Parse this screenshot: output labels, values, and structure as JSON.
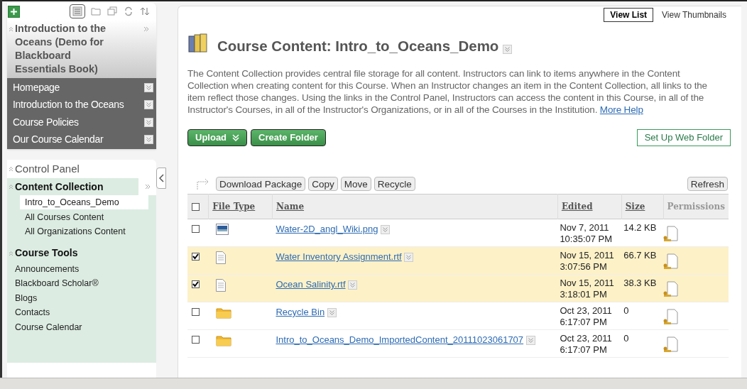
{
  "sidebar": {
    "course_title": "Introduction to the Oceans (Demo for Blackboard Essentials Book)",
    "course_menu": [
      {
        "label": "Homepage"
      },
      {
        "label": "Introduction to the Oceans"
      },
      {
        "label": "Course Policies"
      },
      {
        "label": "Our Course Calendar"
      }
    ],
    "control_panel": {
      "title": "Control Panel",
      "sections": [
        {
          "title": "Content Collection",
          "expand": true,
          "items": [
            {
              "label": "Intro_to_Oceans_Demo",
              "selected": true
            },
            {
              "label": "All Courses Content",
              "selected": false
            },
            {
              "label": "All Organizations Content",
              "selected": false
            }
          ]
        },
        {
          "title": "Course Tools",
          "expand": false,
          "items": [
            {
              "label": "Announcements",
              "selected": false
            },
            {
              "label": "Blackboard Scholar®",
              "selected": false
            },
            {
              "label": "Blogs",
              "selected": false
            },
            {
              "label": "Contacts",
              "selected": false
            },
            {
              "label": "Course Calendar",
              "selected": false
            }
          ]
        }
      ]
    }
  },
  "view_toggle": [
    {
      "label": "View List",
      "selected": true
    },
    {
      "label": "View Thumbnails",
      "selected": false
    }
  ],
  "page_title": "Course Content: Intro_to_Oceans_Demo",
  "description": "The Content Collection provides central file storage for all content. Instructors can link to items anywhere in the Content Collection when creating content for this Course. When an Instructor changes an item in the Content Collection, all links to the item reflect those changes. Using the links in the Control Panel, Instructors can access the content in this Course, in all of the Instructor's Courses, in all of the Instructor's Organizations, or in all of the Courses in the Institution.",
  "help_link": "More Help",
  "action_buttons": [
    {
      "label": "Upload",
      "dropdown": true
    },
    {
      "label": "Create Folder",
      "dropdown": false
    }
  ],
  "web_folder_button": "Set Up Web Folder",
  "toolbar_buttons": [
    "Download Package",
    "Copy",
    "Move",
    "Recycle"
  ],
  "refresh_button": "Refresh",
  "table": {
    "columns": [
      "File Type",
      "Name",
      "Edited",
      "Size",
      "Permissions"
    ],
    "select_all_checked": false,
    "rows": [
      {
        "kind": "image",
        "name": "Water-2D_angl_Wiki.png",
        "edited": [
          "Nov 7, 2011",
          "10:35:07 PM"
        ],
        "size": "14.2 KB",
        "checked": false
      },
      {
        "kind": "document",
        "name": "Water Inventory Assignment.rtf",
        "edited": [
          "Nov 15, 2011",
          "3:07:56 PM"
        ],
        "size": "66.7 KB",
        "checked": true
      },
      {
        "kind": "document",
        "name": "Ocean Salinity.rtf",
        "edited": [
          "Nov 15, 2011",
          "3:18:01 PM"
        ],
        "size": "38.3 KB",
        "checked": true
      },
      {
        "kind": "folder",
        "name": "Recycle Bin",
        "edited": [
          "Oct 23, 2011",
          "6:17:07 PM"
        ],
        "size": "0",
        "checked": false
      },
      {
        "kind": "folder",
        "name": "Intro_to_Oceans_Demo_ImportedContent_20111023061707",
        "edited": [
          "Oct 23, 2011",
          "6:17:07 PM"
        ],
        "size": "0",
        "checked": false
      }
    ]
  }
}
